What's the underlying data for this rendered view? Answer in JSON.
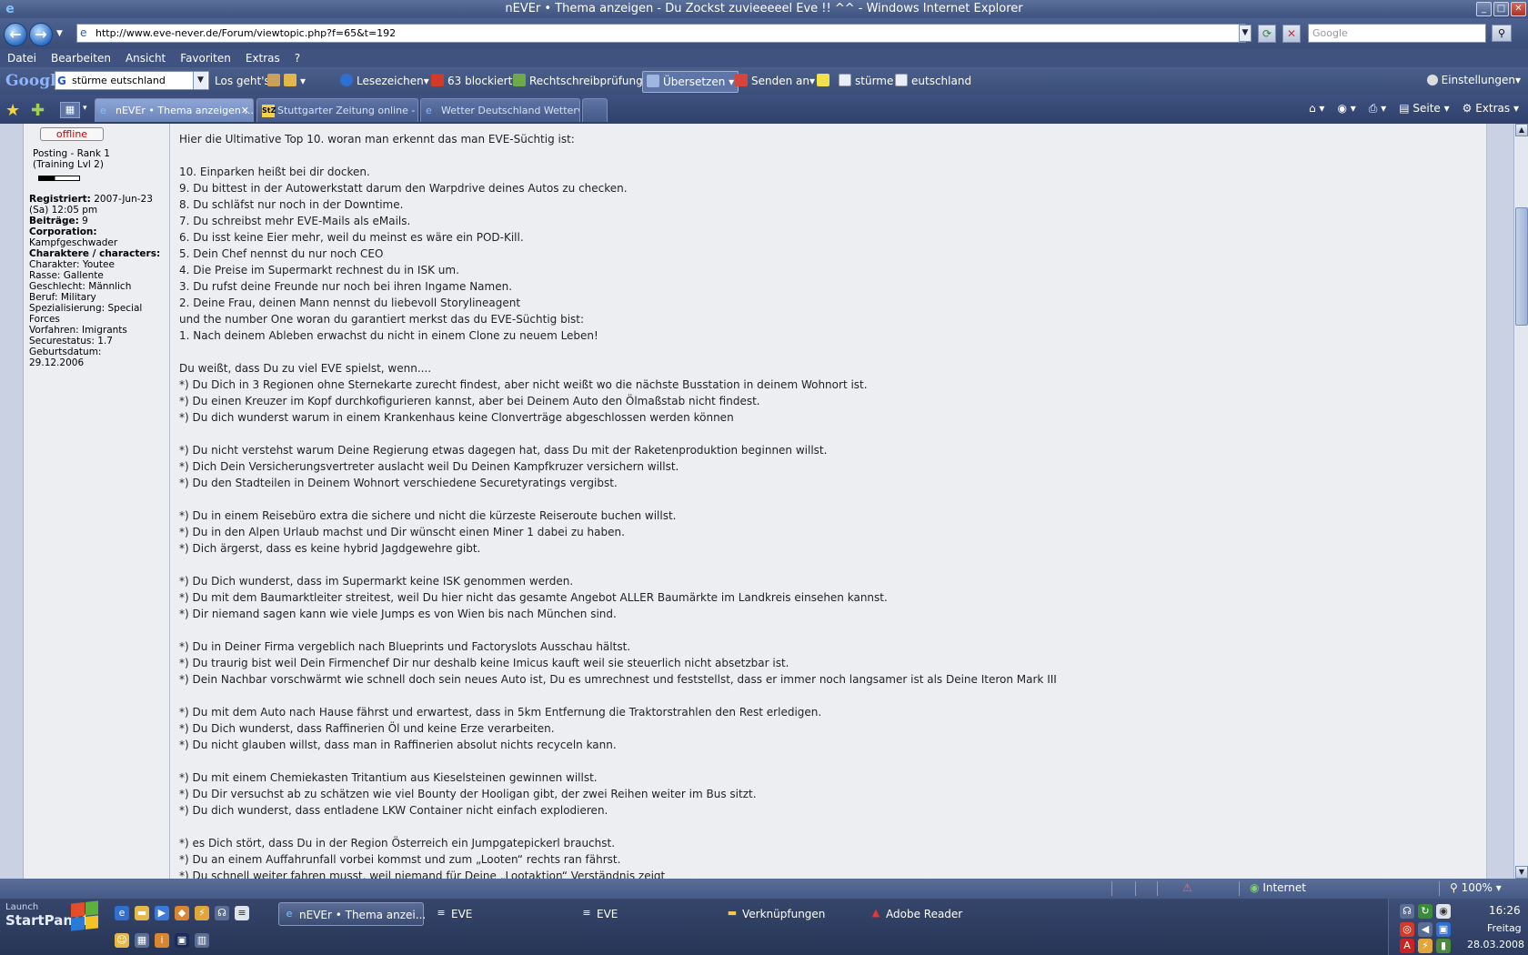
{
  "window": {
    "title": "nEVEr • Thema anzeigen - Du Zockst zuvieeeeel Eve !! ^^ - Windows Internet Explorer"
  },
  "addressbar": {
    "url": "http://www.eve-never.de/Forum/viewtopic.php?f=65&t=192",
    "search_placeholder": "Google"
  },
  "menu": [
    "Datei",
    "Bearbeiten",
    "Ansicht",
    "Favoriten",
    "Extras",
    "?"
  ],
  "google_toolbar": {
    "logo": "Google",
    "query": "stürme eutschland",
    "go": "Los geht's!",
    "bookmarks": "Lesezeichen",
    "blocked": "63 blockiert",
    "spellcheck": "Rechtschreibprüfung",
    "translate": "Übersetzen",
    "send": "Senden an",
    "term1": "stürme",
    "term2": "eutschland",
    "settings": "Einstellungen"
  },
  "tabs": [
    {
      "label": "nEVEr • Thema anzeigen ...",
      "active": true
    },
    {
      "label": "Stuttgarter Zeitung online - S...",
      "active": false
    },
    {
      "label": "Wetter Deutschland Wetterv...",
      "active": false
    }
  ],
  "commandbar": {
    "page": "Seite",
    "extras": "Extras"
  },
  "profile": {
    "status": "offline",
    "rank_line1": "Posting - Rank 1",
    "rank_line2": "(Training Lvl 2)",
    "rank_progress": 0.4,
    "lines": [
      {
        "label": "Registriert:",
        "value": " 2007-Jun-23"
      },
      {
        "label": "",
        "value": "(Sa) 12:05 pm"
      },
      {
        "label": "Beiträge:",
        "value": " 9"
      },
      {
        "label": "Corporation:",
        "value": ""
      },
      {
        "label": "",
        "value": "Kampfgeschwader"
      },
      {
        "label": "Charaktere / characters:",
        "value": ""
      },
      {
        "label": "",
        "value": "Charakter: Youtee"
      },
      {
        "label": "",
        "value": "Rasse: Gallente"
      },
      {
        "label": "",
        "value": "Geschlecht: Männlich"
      },
      {
        "label": "",
        "value": "Beruf: Military"
      },
      {
        "label": "",
        "value": "Spezialisierung: Special"
      },
      {
        "label": "",
        "value": "Forces"
      },
      {
        "label": "",
        "value": "Vorfahren: Imigrants"
      },
      {
        "label": "",
        "value": "Securestatus: 1.7"
      },
      {
        "label": "",
        "value": "Geburtsdatum:"
      },
      {
        "label": "",
        "value": "29.12.2006"
      }
    ]
  },
  "post_lines": [
    "Hier die Ultimative Top 10. woran man erkennt das man EVE-Süchtig ist:",
    "",
    "10. Einparken heißt bei dir docken.",
    "9. Du bittest in der Autowerkstatt darum den Warpdrive deines Autos zu checken.",
    "8. Du schläfst nur noch in der Downtime.",
    "7. Du schreibst mehr EVE-Mails als eMails.",
    "6. Du isst keine Eier mehr, weil du meinst es wäre ein POD-Kill.",
    "5. Dein Chef nennst du nur noch CEO",
    "4. Die Preise im Supermarkt rechnest du in ISK um.",
    "3. Du rufst deine Freunde nur noch bei ihren Ingame Namen.",
    "2. Deine Frau, deinen Mann nennst du liebevoll Storylineagent",
    "und the number One woran du garantiert merkst das du EVE-Süchtig bist:",
    "1. Nach deinem Ableben erwachst du nicht in einem Clone zu neuem Leben!",
    "",
    "Du weißt, dass Du zu viel EVE spielst, wenn....",
    "*) Du Dich in 3 Regionen ohne Sternekarte zurecht findest, aber nicht weißt wo die nächste Busstation in deinem Wohnort ist.",
    "*) Du einen Kreuzer im Kopf durchkofigurieren kannst, aber bei Deinem Auto den Ölmaßstab nicht findest.",
    "*) Du dich wunderst warum in einem Krankenhaus keine Clonverträge abgeschlossen werden können",
    "",
    "*) Du nicht verstehst warum Deine Regierung etwas dagegen hat, dass Du mit der Raketenproduktion beginnen willst.",
    "*) Dich Dein Versicherungsvertreter auslacht weil Du Deinen Kampfkruzer versichern willst.",
    "*) Du den Stadteilen in Deinem Wohnort verschiedene Securetyratings vergibst.",
    "",
    "*) Du in einem Reisebüro extra die sichere und nicht die kürzeste Reiseroute buchen willst.",
    "*) Du in den Alpen Urlaub machst und Dir wünscht einen Miner 1 dabei zu haben.",
    "*) Dich ärgerst, dass es keine hybrid Jagdgewehre gibt.",
    "",
    "*) Du Dich wunderst, dass im Supermarkt keine ISK genommen werden.",
    "*) Du mit dem Baumarktleiter streitest, weil Du hier nicht das gesamte Angebot ALLER Baumärkte im Landkreis einsehen kannst.",
    "*) Dir niemand sagen kann wie viele Jumps es von Wien bis nach München sind.",
    "",
    "*) Du in Deiner Firma vergeblich nach Blueprints und Factoryslots Ausschau hältst.",
    "*) Du traurig bist weil Dein Firmenchef Dir nur deshalb keine Imicus kauft weil sie steuerlich nicht absetzbar ist.",
    "*) Dein Nachbar vorschwärmt wie schnell doch sein neues Auto ist, Du es umrechnest und feststellst, dass er immer noch langsamer ist als Deine Iteron Mark III",
    "",
    "*) Du mit dem Auto nach Hause fährst und erwartest, dass in 5km Entfernung die Traktorstrahlen den Rest erledigen.",
    "*) Du Dich wunderst, dass Raffinerien Öl und keine Erze verarbeiten.",
    "*) Du nicht glauben willst, dass man in Raffinerien absolut nichts recyceln kann.",
    "",
    "*) Du mit einem Chemiekasten Tritantium aus Kieselsteinen gewinnen willst.",
    "*) Du Dir versuchst ab zu schätzen wie viel Bounty der Hooligan gibt, der zwei Reihen weiter im Bus sitzt.",
    "*) Du dich wunderst, dass entladene LKW Container nicht einfach explodieren.",
    "",
    "*) es Dich stört, dass Du in der Region Österreich ein Jumpgatepickerl brauchst.",
    "*) Du an einem Auffahrunfall vorbei kommst und zum „Looten“ rechts ran fährst.",
    "*) Du schnell weiter fahren musst, weil niemand für Deine „Lootaktion“ Verständnis zeigt"
  ],
  "statusbar": {
    "zone": "Internet",
    "zoom": "100%"
  },
  "taskbar": {
    "launch": "Launch",
    "startpanel": "StartPanel",
    "tasks": [
      {
        "label": "nEVEr • Thema anzei...",
        "active": true
      },
      {
        "label": "EVE",
        "active": false
      },
      {
        "label": "EVE",
        "active": false
      },
      {
        "label": "Verknüpfungen",
        "active": false
      },
      {
        "label": "Adobe Reader",
        "active": false
      }
    ],
    "clock_time": "16:26",
    "clock_day": "Freitag",
    "clock_date": "28.03.2008"
  },
  "colors": {
    "accent": "#3f5280",
    "offline": "#cc0000",
    "page_bg": "#eceef2"
  }
}
